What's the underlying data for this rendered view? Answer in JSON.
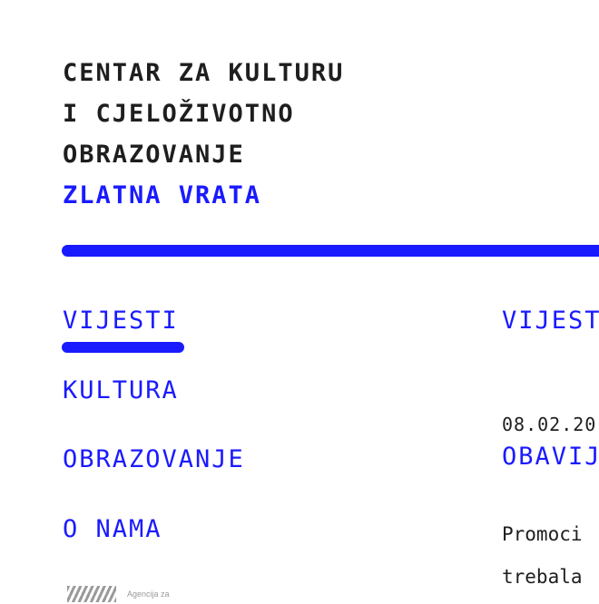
{
  "header": {
    "title_lines": [
      "CENTAR ZA KULTURU",
      "I CJELOŽIVOTNO",
      "OBRAZOVANJE"
    ],
    "subtitle": "ZLATNA VRATA"
  },
  "nav": {
    "items": [
      {
        "label": "VIJESTI",
        "active": true
      },
      {
        "label": "KULTURA"
      },
      {
        "label": "OBRAZOVANJE"
      },
      {
        "label": "O NAMA"
      }
    ]
  },
  "main": {
    "heading": "VIJEST",
    "news_date": "08.02.20",
    "news_title": "OBAVIJ",
    "excerpt_lines": [
      "Promoci",
      "trebala"
    ]
  },
  "footer": {
    "agency_logo_text": "Agencija za"
  },
  "colors": {
    "accent": "#1a1aff",
    "text": "#1e1e1e"
  }
}
